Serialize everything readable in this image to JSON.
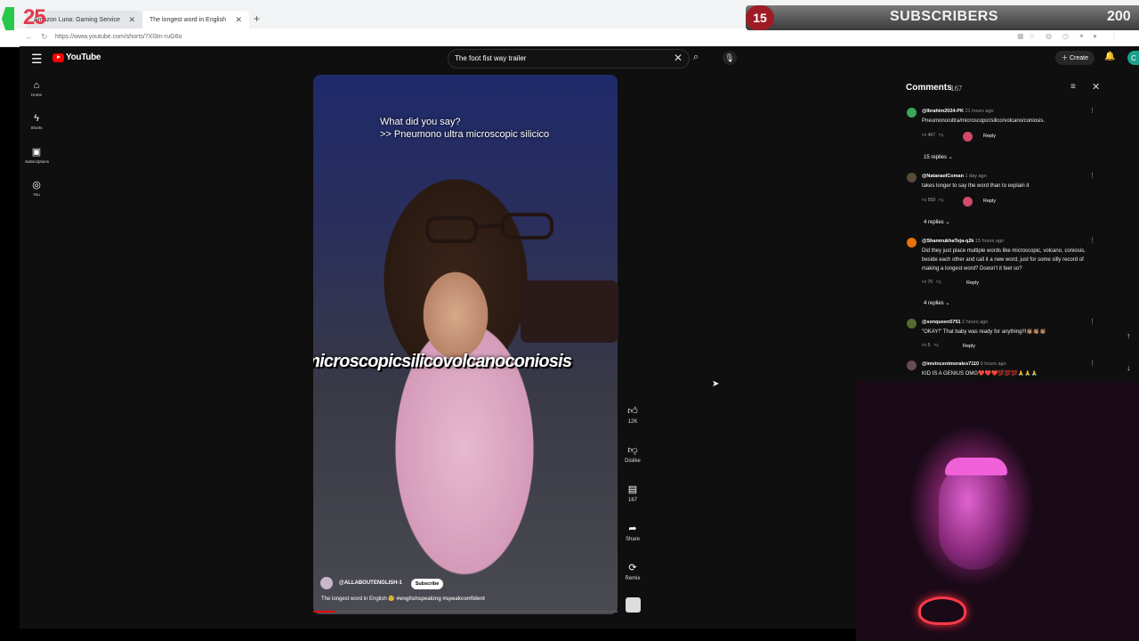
{
  "browser": {
    "tabs": [
      {
        "label": "Amazon Luna: Gaming Service"
      },
      {
        "label": "The longest word in English"
      }
    ],
    "url": "https://www.youtube.com/shorts/7Xl3m-ruG6o"
  },
  "overlay": {
    "logo_number": "25",
    "sub_count": "15",
    "sub_label": "SUBSCRIBERS",
    "sub_goal": "200"
  },
  "youtube": {
    "logo_text": "YouTube",
    "search_value": "The foot fist way trailer",
    "create_label": "Create",
    "avatar_letter": "C",
    "sidebar": [
      {
        "icon": "home-icon",
        "label": "Home"
      },
      {
        "icon": "shorts-icon",
        "label": "Shorts"
      },
      {
        "icon": "subscriptions-icon",
        "label": "Subscriptions"
      },
      {
        "icon": "you-icon",
        "label": "You"
      }
    ]
  },
  "video": {
    "caption_line1": "What did you say?",
    "caption_line2": ">> Pneumono ultra microscopic silicico",
    "big_word": "pneumonoultramicroscopicsilicovolcanoconiosis",
    "channel": "@ALLABOUTENGLISH-1",
    "subscribe_label": "Subscribe",
    "title": "The longest word in English 🧐",
    "tags": "#englishspeaking #speakconfident",
    "progress": 0.07,
    "actions": [
      {
        "icon": "like-icon",
        "label": "12K"
      },
      {
        "icon": "dislike-icon",
        "label": "Dislike"
      },
      {
        "icon": "comment-icon",
        "label": "167"
      },
      {
        "icon": "share-icon",
        "label": "Share"
      },
      {
        "icon": "remix-icon",
        "label": "Remix"
      }
    ]
  },
  "comments": {
    "header": "Comments",
    "count": "167",
    "items": [
      {
        "user": "@Ibrahim2024-PK",
        "time": "21 hours ago",
        "text": "Pneumono/ultra/microscopic/silico/volcano/coniosis.",
        "likes": "467",
        "reply": "Reply",
        "replies": "15 replies",
        "color": "#3aa757"
      },
      {
        "user": "@NatanaelComan",
        "time": "1 day ago",
        "text": "takes longer to say the word than to explain it",
        "likes": "559",
        "reply": "Reply",
        "replies": "4 replies",
        "color": "#5a4a3a"
      },
      {
        "user": "@ShanmukhaTeja-q2k",
        "time": "15 hours ago",
        "text": "Did they just place multiple words like microscopic, volcano, coniosis, beside each other and call it a new word, just for some silly record of making a longest word? Doesn't it feel so?",
        "likes": "70",
        "reply": "Reply",
        "replies": "4 replies",
        "color": "#e8710a"
      },
      {
        "user": "@sonqueen5751",
        "time": "2 hours ago",
        "text": "\"OKAY!\" That baby was ready for anything!!!👏🏽👏🏽👏🏽",
        "likes": "5",
        "reply": "Reply",
        "replies": "",
        "color": "#556b2f"
      },
      {
        "user": "@imvincentmorales7110",
        "time": "9 hours ago",
        "text": "KID IS A GENIUS OMG❤️❤️❤️💯💯💯🙏🙏🙏",
        "likes": "",
        "reply": "",
        "replies": "",
        "color": "#6a4a5a"
      }
    ]
  }
}
